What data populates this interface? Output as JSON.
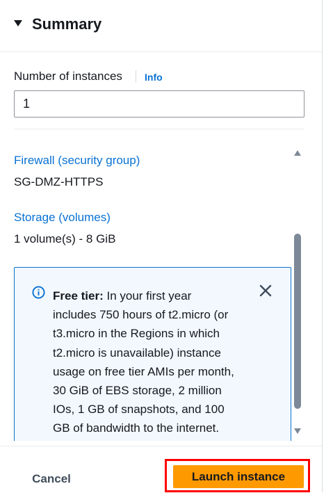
{
  "summary": {
    "title": "Summary"
  },
  "instances": {
    "label": "Number of instances",
    "info_label": "Info",
    "value": "1"
  },
  "details": [
    {
      "key": "Firewall (security group)",
      "value": "SG-DMZ-HTTPS"
    },
    {
      "key": "Storage (volumes)",
      "value": "1 volume(s) - 8 GiB"
    }
  ],
  "free_tier_alert": {
    "bold_label": "Free tier:",
    "lines": [
      " In your first year",
      "includes 750 hours of t2.micro (or",
      "t3.micro in the Regions in which",
      "t2.micro is unavailable) instance",
      "usage on free tier AMIs per month,",
      "30 GiB of EBS storage, 2 million",
      "IOs, 1 GB of snapshots, and 100",
      "GB of bandwidth to the internet."
    ]
  },
  "footer": {
    "cancel_label": "Cancel",
    "launch_label": "Launch instance"
  },
  "colors": {
    "link": "#0972d3",
    "primary_button": "#ff9900",
    "alert_border": "#0972d3",
    "alert_background": "#f2f8fd",
    "highlight_box": "#ff0000"
  },
  "icons": {
    "section_toggle": "caret-down-icon",
    "alert_info": "info-circle-icon",
    "alert_dismiss": "close-icon",
    "scroll_up": "scroll-up-arrow",
    "scroll_down": "scroll-down-arrow"
  }
}
